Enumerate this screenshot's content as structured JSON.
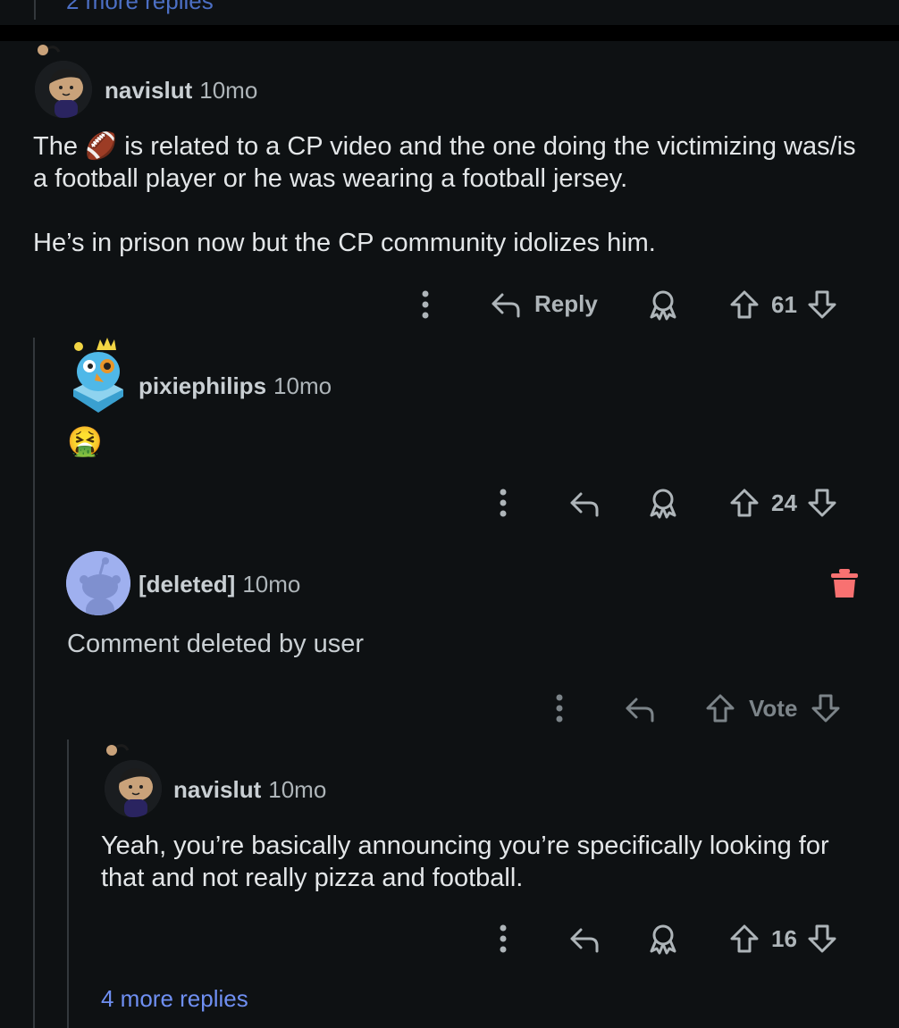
{
  "prev_thread": {
    "more_replies_label": "2 more replies"
  },
  "comments": [
    {
      "username": "navislut",
      "age": "10mo",
      "avatar": "snoo-avatar-dark-hair",
      "text_before_emoji": "The ",
      "emoji": "🏈",
      "text_after_emoji": " is related to a CP video and the one doing the victimizing was/is a football player or he was wearing a football jersey.",
      "paragraph2": "He’s in prison now but the CP community idolizes him.",
      "reply_label": "Reply",
      "votes": "61"
    },
    {
      "username": "pixiephilips",
      "age": "10mo",
      "avatar": "blue-bird-crown-avatar",
      "text": "🤮",
      "votes": "24"
    },
    {
      "username": "[deleted]",
      "age": "10mo",
      "avatar": "deleted-snoo-avatar",
      "text": "Comment deleted by user",
      "vote_label": "Vote"
    },
    {
      "username": "navislut",
      "age": "10mo",
      "avatar": "snoo-avatar-dark-hair",
      "text": "Yeah, you’re basically announcing you’re specifically looking for that and not really pizza and football.",
      "votes": "16"
    }
  ],
  "more_replies_label": "4 more replies",
  "colors": {
    "background": "#0e1113",
    "link": "#6f8ff2",
    "delete_icon": "#f87171",
    "muted": "#aeb5b9"
  }
}
